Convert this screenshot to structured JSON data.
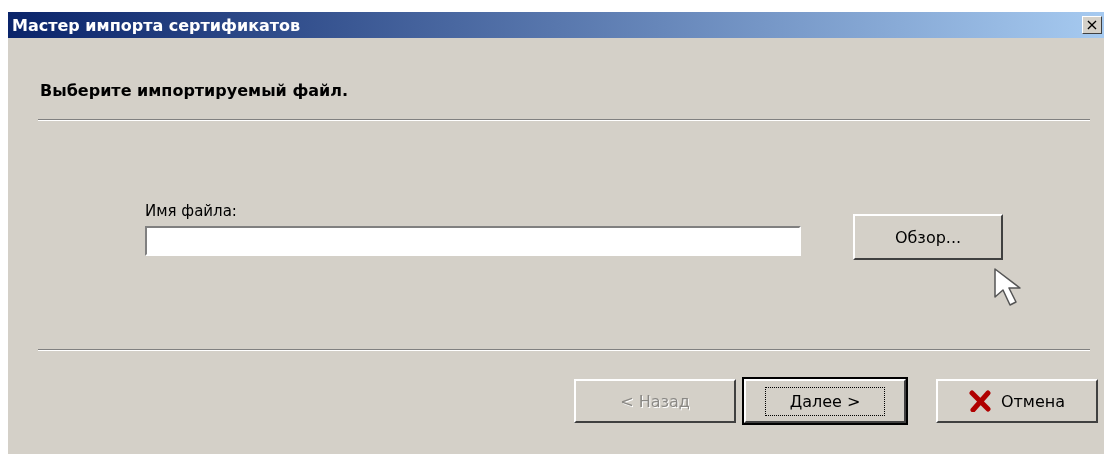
{
  "window": {
    "title": "Мастер импорта сертификатов",
    "close": "×"
  },
  "heading": "Выберите импортируемый файл.",
  "file_field": {
    "label": "Имя файла:"
  },
  "browse_button": {
    "label": "Обзор..."
  },
  "buttons": [
    {
      "label": "< Назад",
      "kind": "plain",
      "disabled": true,
      "focused": false
    },
    {
      "label": "Далее >",
      "kind": "plain",
      "disabled": false,
      "focused": true
    },
    {
      "label": "Отмена",
      "kind": "cancel",
      "disabled": false,
      "focused": false
    }
  ]
}
